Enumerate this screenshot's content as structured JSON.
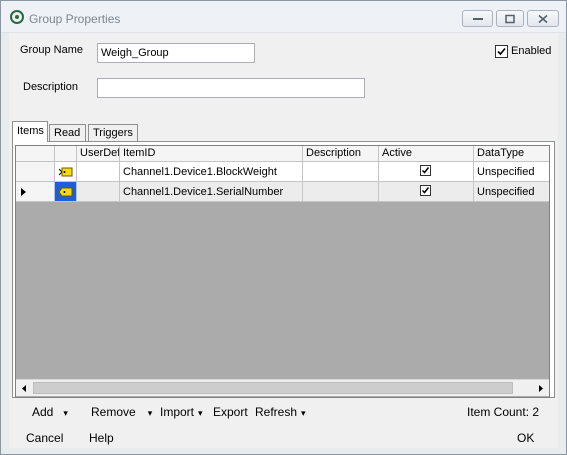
{
  "window": {
    "title": "Group Properties",
    "icons": {
      "app": "kepware-app-icon",
      "minimize": "minimize-icon",
      "maximize": "maximize-icon",
      "close": "close-icon"
    }
  },
  "form": {
    "group_name_label": "Group Name",
    "group_name_value": "Weigh_Group",
    "description_label": "Description",
    "description_value": "",
    "enabled_label": "Enabled",
    "enabled_checked": true
  },
  "tabs": [
    {
      "label": "Items",
      "active": true
    },
    {
      "label": "Read",
      "active": false
    },
    {
      "label": "Triggers",
      "active": false
    }
  ],
  "grid": {
    "columns": [
      "UserDef",
      "ItemID",
      "Description",
      "Active",
      "DataType"
    ],
    "rows": [
      {
        "item_id": "Channel1.Device1.BlockWeight",
        "description": "",
        "active": true,
        "data_type": "Unspecified",
        "selected": false
      },
      {
        "item_id": "Channel1.Device1.SerialNumber",
        "description": "",
        "active": true,
        "data_type": "Unspecified",
        "selected": true
      }
    ]
  },
  "toolbar": {
    "add": "Add",
    "remove": "Remove",
    "import": "Import",
    "export": "Export",
    "refresh": "Refresh",
    "item_count": "Item Count: 2"
  },
  "buttons": {
    "cancel": "Cancel",
    "help": "Help",
    "ok": "OK"
  }
}
